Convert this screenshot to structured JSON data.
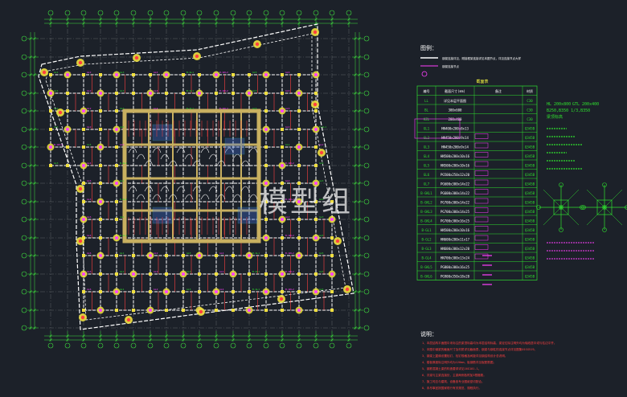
{
  "watermark": "模型组",
  "legend": {
    "title": "图例：",
    "lines": [
      "钢梁连接详见，刚接框架连接详见本图节点，详见连接节点大样",
      "钢梁连接节点"
    ]
  },
  "member_table": {
    "title": "截面表",
    "headers": [
      "编号",
      "截面尺寸(mm)",
      "备注",
      "材质"
    ],
    "rows": [
      [
        "LL",
        "详见本层平面图",
        "",
        "C30"
      ],
      [
        "BL",
        "300x600",
        "",
        "C30"
      ],
      [
        "KZL",
        "200x400",
        "",
        "C30"
      ],
      [
        "GL1",
        "HN400x200x8x13",
        "",
        "Q345B"
      ],
      [
        "GL2",
        "HN450x200x9x14",
        "",
        "Q345B"
      ],
      [
        "GL3",
        "HN450x200x9x14",
        "",
        "Q345B"
      ],
      [
        "GL4",
        "HN500x200x10x16",
        "",
        "Q345B"
      ],
      [
        "GL5",
        "HN500x200x10x16",
        "",
        "Q345B"
      ],
      [
        "GL6",
        "PG500x250x12x20",
        "",
        "Q345B"
      ],
      [
        "GL7",
        "PG600x300x14x22",
        "",
        "Q345B"
      ],
      [
        "B-GKL1",
        "PG600x300x14x22",
        "",
        "Q345B"
      ],
      [
        "B-GKL2",
        "PG700x300x14x22",
        "",
        "Q345B"
      ],
      [
        "B-GKL3",
        "PG700x300x14x25",
        "",
        "Q345B"
      ],
      [
        "B-GKL4",
        "PG700x300x16x25",
        "",
        "Q345B"
      ],
      [
        "B-GL1",
        "HN500x200x10x16",
        "",
        "Q345B"
      ],
      [
        "B-GL2",
        "HN600x200x11x17",
        "",
        "Q345B"
      ],
      [
        "B-GL3",
        "HN600x300x12x20",
        "",
        "Q345B"
      ],
      [
        "B-GL4",
        "HN700x300x13x24",
        "",
        "Q345B"
      ],
      [
        "B-GKL5",
        "PG800x300x16x25",
        "",
        "Q345B"
      ],
      [
        "B-GKL6",
        "PG900x350x18x28",
        "",
        "Q345B"
      ]
    ]
  },
  "spec_text": {
    "line1": "HL 200x800",
    "line2": "GTL 200x400",
    "line3": "B250,B350 1/3,B350",
    "line4": "梁顶标高"
  },
  "notes": {
    "title": "说明：",
    "lines": [
      "1、本层结构平面图中未标注的梁顶标高均为本层结构标高，梁定位除注明外均为轴线居中或与柱边平齐。",
      "2、本图中钢梁的截面尺寸及材质详见截面表，钢梁与钢柱的连接节点详见图集01SG519。",
      "3、钢梁上翼缘设置栓钉，栓钉规格及间距详见钢结构设计总说明。",
      "4、楼板厚度除注明外均为120mm，板钢筋详见板配筋图。",
      "5、钢筋混凝土梁的构造要求详见16G101-1。",
      "6、次梁与主梁连接处，主梁两侧各附加3根箍筋。",
      "7、施工时应与建筑、设备各专业图纸密切配合。",
      "8、未尽事宜按国家现行有关规范、规程执行。"
    ]
  },
  "colors": {
    "background": "#1c2129",
    "axis": "#3fe23f",
    "grid": "#c8c8c8",
    "beam": "#ffffff",
    "column": "#f0e040",
    "core": "#c8b060",
    "magenta": "#ff40ff",
    "table": "#2fe02f",
    "red": "#ff4040",
    "cyan": "#40e0ff"
  }
}
